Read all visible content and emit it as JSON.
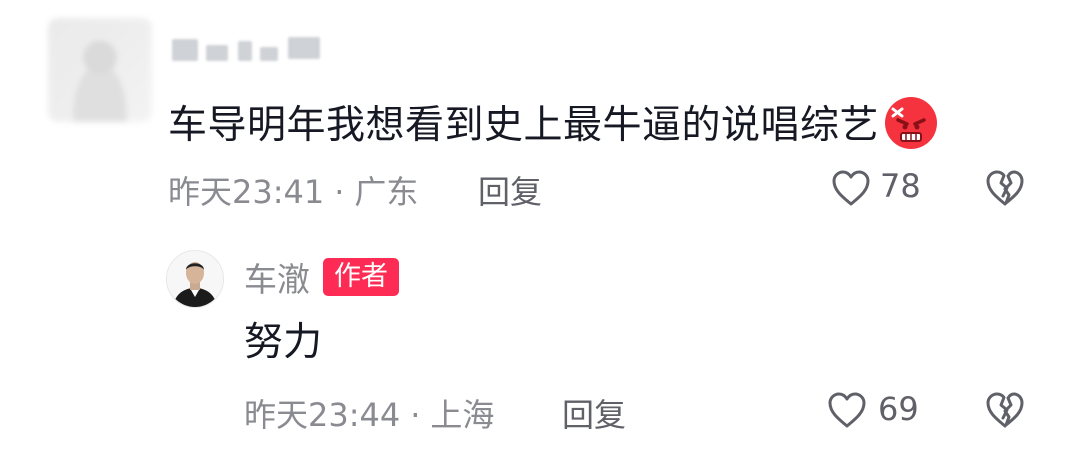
{
  "comment": {
    "text": "车导明年我想看到史上最牛逼的说唱综艺",
    "emoji": "angry-face-emoji",
    "time": "昨天23:41",
    "separator": "·",
    "location": "广东",
    "reply_label": "回复",
    "likes": "78"
  },
  "reply": {
    "author": "车澈",
    "badge": "作者",
    "text": "努力",
    "time": "昨天23:44",
    "separator": "·",
    "location": "上海",
    "reply_label": "回复",
    "likes": "69"
  },
  "colors": {
    "text": "#161823",
    "meta": "#8a8b91",
    "badge": "#fe2c55",
    "emoji": "#f5333f"
  }
}
